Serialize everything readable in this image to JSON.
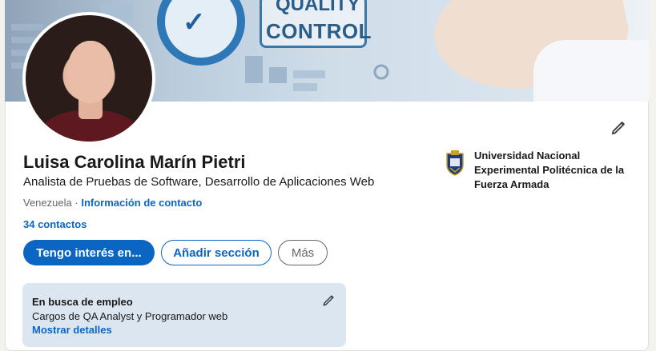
{
  "profile": {
    "name": "Luisa Carolina Marín Pietri",
    "headline": "Analista de Pruebas de Software, Desarrollo de Aplicaciones Web",
    "location": "Venezuela",
    "separator": "·",
    "contact_info_label": "Información de contacto",
    "connections": "34 contactos"
  },
  "banner": {
    "line1": "QUALITY",
    "line2": "CONTROL"
  },
  "actions": {
    "primary": "Tengo interés en...",
    "add_section": "Añadir sección",
    "more": "Más"
  },
  "education": {
    "lines": [
      "Universidad Nacional",
      "Experimental Politécnica de la",
      "Fuerza Armada"
    ]
  },
  "open_to_work": {
    "title": "En busca de empleo",
    "description": "Cargos de QA Analyst y Programador web",
    "link": "Mostrar detalles"
  },
  "icons": {
    "edit": "pencil-icon",
    "school_logo": "university-crest-icon"
  },
  "colors": {
    "accent": "#0a66c2",
    "open_card_bg": "#dce6f1"
  }
}
